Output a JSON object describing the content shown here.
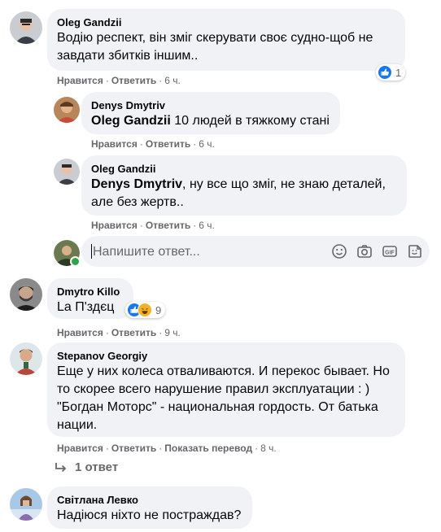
{
  "actions": {
    "like": "Нравится",
    "reply": "Ответить",
    "translate": "Показать перевод",
    "separator": "·"
  },
  "comments": [
    {
      "author": "Oleg Gandzii",
      "text_line1": "Водію респект, він зміг скерувати своє судно-щоб не",
      "text_line2": "завдати збитків іншим..",
      "time": "6 ч.",
      "reactions_count": "1"
    },
    {
      "author": "Denys Dmytriv",
      "mention": "Oleg Gandzii",
      "text": "10 людей в тяжкому стані",
      "time": "6 ч."
    },
    {
      "author": "Oleg Gandzii",
      "mention": "Denys Dmytriv",
      "text_line1": ", ну все що зміг, не знаю деталей,",
      "text_line2": "але без жертв..",
      "time": "6 ч."
    },
    {
      "author": "Dmytro Killo",
      "text": "La П'здєц",
      "time": "9 ч.",
      "reactions_count": "9"
    },
    {
      "author": "Stepanov Georgiy",
      "text_line1": "Еще у них колеса отваливаются. И перекос бывает. Но",
      "text_line2": "то скорее всего нарушение правил эксплуатации : )",
      "text_line3": "\"Богдан Моторс\" - национальная гордость. От батька",
      "text_line4": "нации.",
      "time": "8 ч."
    },
    {
      "author": "Світлана Левко",
      "text": "Надіюся ніхто не постраждав?"
    }
  ],
  "reply_box": {
    "placeholder": "Напишите ответ..."
  },
  "replies_link": {
    "label": "1 ответ"
  },
  "colors": {
    "bubble": "#f0f2f5",
    "meta_text": "#65676b",
    "like_blue": "#1877f2",
    "online_green": "#31a24c"
  }
}
